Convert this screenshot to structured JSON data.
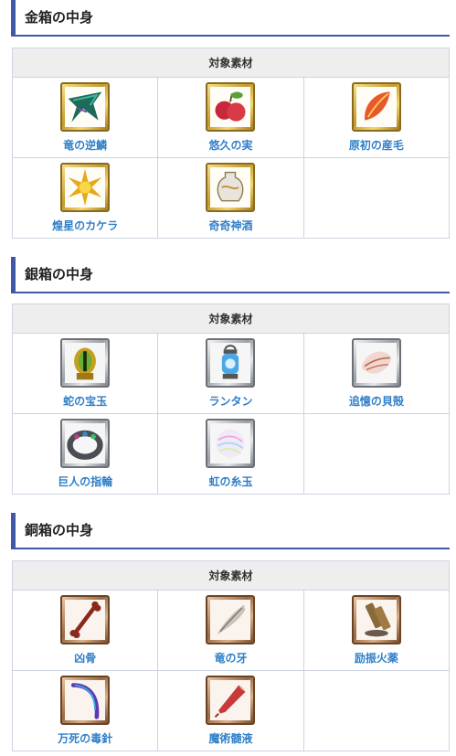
{
  "sections": [
    {
      "title": "金箱の中身",
      "column_header": "対象素材",
      "items": [
        {
          "name": "竜の逆鱗",
          "icon": "dragon-scale-icon"
        },
        {
          "name": "悠久の実",
          "icon": "fruit-icon"
        },
        {
          "name": "原初の産毛",
          "icon": "feather-icon"
        },
        {
          "name": "煌星のカケラ",
          "icon": "star-fragment-icon"
        },
        {
          "name": "奇奇神酒",
          "icon": "sake-vase-icon"
        }
      ]
    },
    {
      "title": "銀箱の中身",
      "column_header": "対象素材",
      "items": [
        {
          "name": "蛇の宝玉",
          "icon": "serpent-gem-icon"
        },
        {
          "name": "ランタン",
          "icon": "lantern-icon"
        },
        {
          "name": "追憶の貝殻",
          "icon": "shell-icon"
        },
        {
          "name": "巨人の指輪",
          "icon": "ring-icon"
        },
        {
          "name": "虹の糸玉",
          "icon": "rainbow-yarn-icon"
        }
      ]
    },
    {
      "title": "銅箱の中身",
      "column_header": "対象素材",
      "items": [
        {
          "name": "凶骨",
          "icon": "bone-icon"
        },
        {
          "name": "竜の牙",
          "icon": "dragon-fang-icon"
        },
        {
          "name": "励振火薬",
          "icon": "gunpowder-icon"
        },
        {
          "name": "万死の毒針",
          "icon": "poison-needle-icon"
        },
        {
          "name": "魔術髄液",
          "icon": "ampoule-icon"
        }
      ]
    }
  ]
}
